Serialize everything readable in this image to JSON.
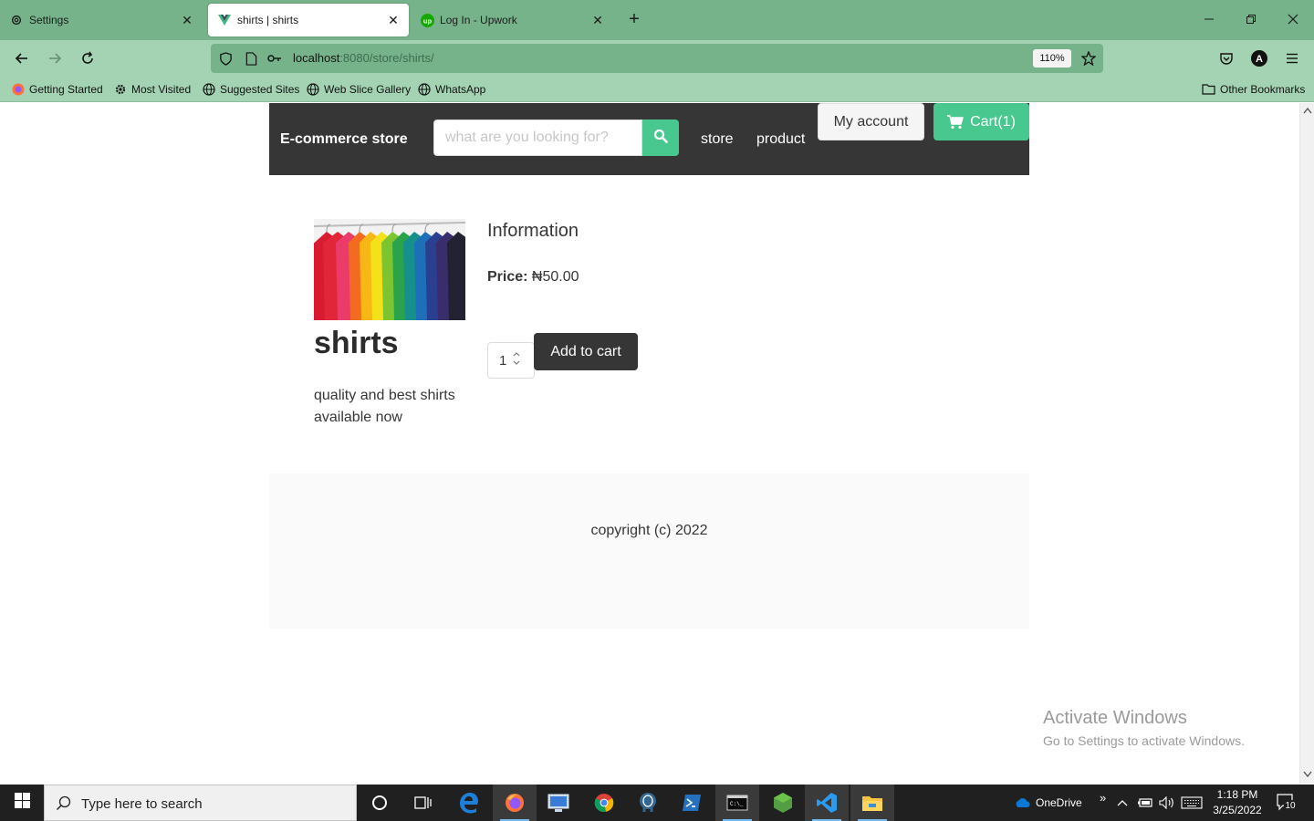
{
  "browser": {
    "tabs": [
      {
        "title": "Settings",
        "icon": "gear-icon",
        "active": false
      },
      {
        "title": "shirts | shirts",
        "icon": "vue-logo-icon",
        "active": true
      },
      {
        "title": "Log In - Upwork",
        "icon": "upwork-logo-icon",
        "active": false
      }
    ],
    "tab_close_glyph": "✕",
    "new_tab_glyph": "+",
    "url_host": "localhost",
    "url_rest": ":8080/store/shirts/",
    "zoom": "110%",
    "bookmarks": [
      {
        "label": "Getting Started",
        "icon": "firefox-icon"
      },
      {
        "label": "Most Visited",
        "icon": "gear-icon"
      },
      {
        "label": "Suggested Sites",
        "icon": "globe-icon"
      },
      {
        "label": "Web Slice Gallery",
        "icon": "globe-icon"
      },
      {
        "label": "WhatsApp",
        "icon": "globe-icon"
      }
    ],
    "other_bookmarks": "Other Bookmarks",
    "profile_initial": "A"
  },
  "site": {
    "brand": "E-commerce store",
    "search_placeholder": "what are you looking for?",
    "nav_links": [
      "store",
      "product"
    ],
    "account_label": "My account",
    "cart_label": "Cart(1)",
    "accent_color": "#48c78e",
    "header_color": "#363636"
  },
  "product": {
    "name": "shirts",
    "description": "quality and best shirts available now",
    "info_heading": "Information",
    "price_label": "Price:",
    "price_value": "₦50.00",
    "quantity": "1",
    "add_to_cart_label": "Add to cart"
  },
  "footer": {
    "copyright": "copyright (c) 2022"
  },
  "watermark": {
    "title": "Activate Windows",
    "subtitle": "Go to Settings to activate Windows."
  },
  "taskbar": {
    "search_placeholder": "Type here to search",
    "onedrive_label": "OneDrive",
    "time": "1:18 PM",
    "date": "3/25/2022",
    "notification_count": "10"
  }
}
